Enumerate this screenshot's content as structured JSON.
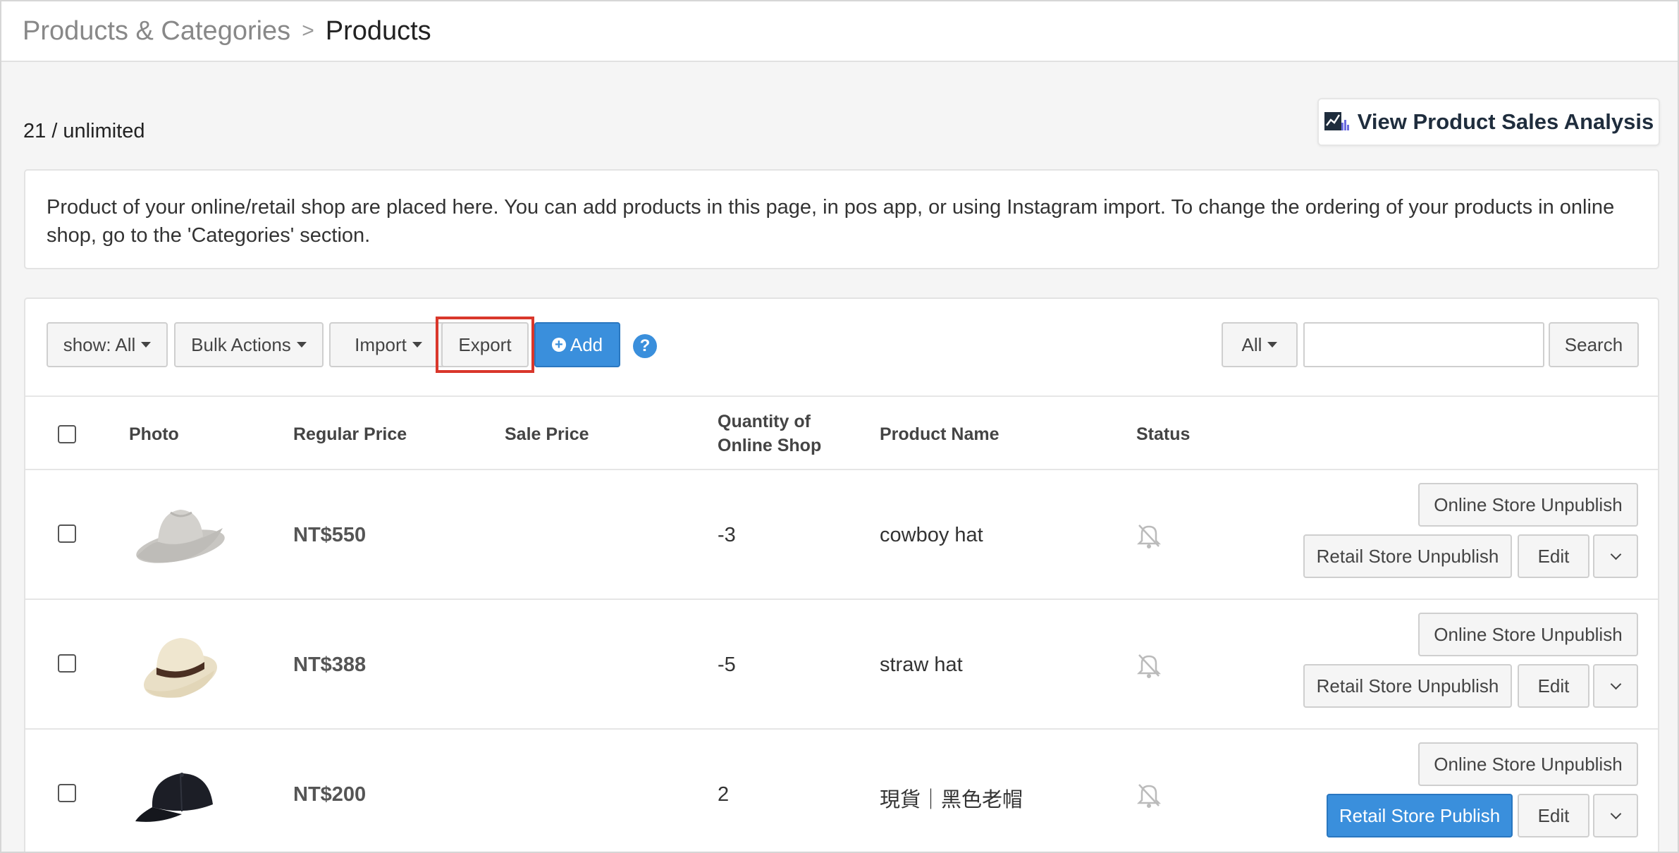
{
  "breadcrumb": {
    "parent": "Products & Categories",
    "separator": ">",
    "current": "Products"
  },
  "quota": "21 / unlimited",
  "analysis_button": {
    "label": "View Product Sales Analysis",
    "icon": "chart-icon"
  },
  "info_text": "Product of your online/retail shop are placed here. You can add products in this page, in pos app, or using Instagram import. To change the ordering of your products in online shop, go to the 'Categories' section.",
  "toolbar": {
    "show_label": "show: All",
    "bulk_label": "Bulk Actions",
    "import_label": "Import",
    "export_label": "Export",
    "add_label": "Add",
    "help_icon": "?",
    "filter_label": "All",
    "search_value": "",
    "search_placeholder": "",
    "search_label": "Search",
    "highlight_color": "#d9372b",
    "accent_color": "#3a8fdc"
  },
  "columns": {
    "photo": "Photo",
    "regular_price": "Regular Price",
    "sale_price": "Sale Price",
    "qty_line1": "Quantity of",
    "qty_line2": "Online Shop",
    "product_name": "Product Name",
    "status": "Status"
  },
  "products": [
    {
      "image": "cowboy-hat-image",
      "regular_price": "NT$550",
      "sale_price": "",
      "quantity": "-3",
      "name": "cowboy hat",
      "status_icon": "bell-off-icon",
      "online_action": "Online Store Unpublish",
      "retail_action": "Retail Store Unpublish",
      "edit_label": "Edit"
    },
    {
      "image": "straw-hat-image",
      "regular_price": "NT$388",
      "sale_price": "",
      "quantity": "-5",
      "name": "straw hat",
      "status_icon": "bell-off-icon",
      "online_action": "Online Store Unpublish",
      "retail_action": "Retail Store Unpublish",
      "edit_label": "Edit"
    },
    {
      "image": "black-cap-image",
      "regular_price": "NT$200",
      "sale_price": "",
      "quantity": "2",
      "name": "現貨｜黑色老帽",
      "status_icon": "bell-off-icon",
      "online_action": "Online Store Unpublish",
      "retail_action": "Retail Store Publish",
      "edit_label": "Edit"
    }
  ]
}
